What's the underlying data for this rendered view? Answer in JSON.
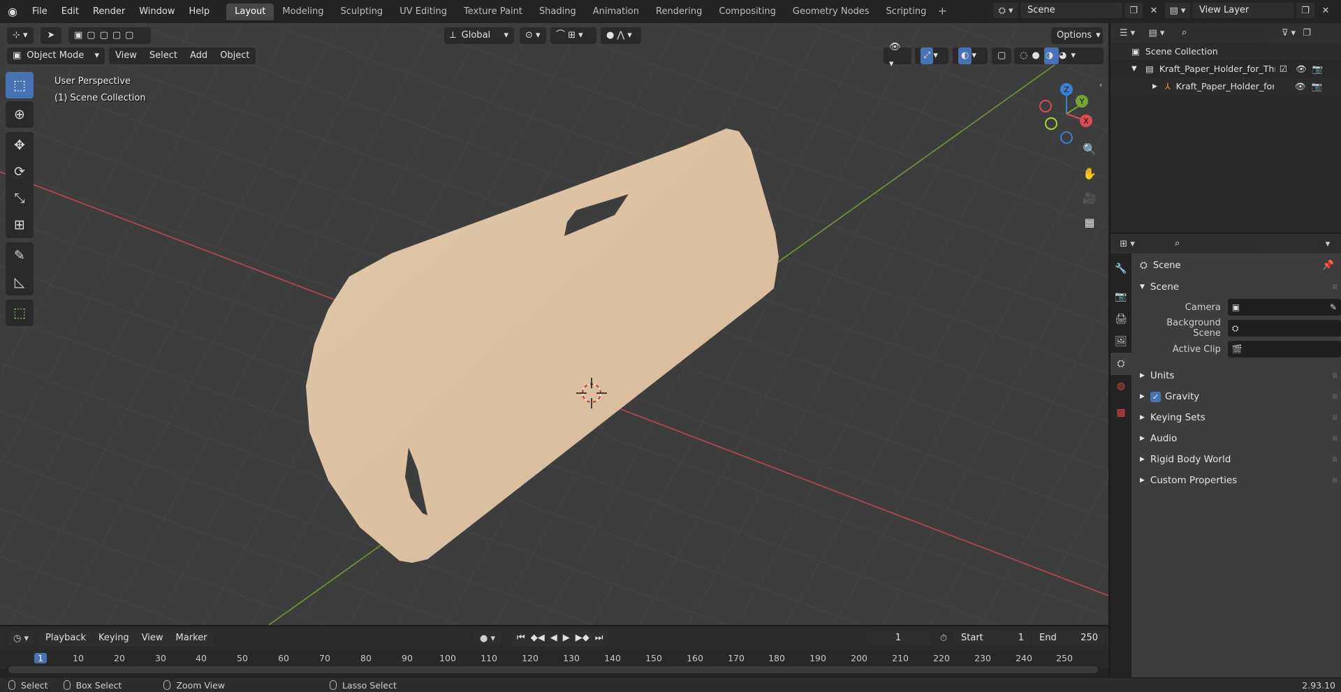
{
  "topbar": {
    "menus": [
      "File",
      "Edit",
      "Render",
      "Window",
      "Help"
    ],
    "workspaces": [
      "Layout",
      "Modeling",
      "Sculpting",
      "UV Editing",
      "Texture Paint",
      "Shading",
      "Animation",
      "Rendering",
      "Compositing",
      "Geometry Nodes",
      "Scripting"
    ],
    "active_workspace": "Layout",
    "scene_name": "Scene",
    "view_layer": "View Layer"
  },
  "viewport": {
    "mode": "Object Mode",
    "menus": [
      "View",
      "Select",
      "Add",
      "Object"
    ],
    "transform_orientation": "Global",
    "options_label": "Options",
    "perspective_label": "User Perspective",
    "collection_label": "(1) Scene Collection",
    "gizmo_axes": {
      "x": "X",
      "y": "Y",
      "z": "Z"
    }
  },
  "outliner": {
    "root": "Scene Collection",
    "collection": "Kraft_Paper_Holder_for_Three",
    "object": "Kraft_Paper_Holder_for_T"
  },
  "properties": {
    "context_title": "Scene",
    "panel_title": "Scene",
    "fields": [
      {
        "label": "Camera",
        "value": ""
      },
      {
        "label": "Background Scene",
        "value": ""
      },
      {
        "label": "Active Clip",
        "value": ""
      }
    ],
    "sections": [
      "Units",
      "Gravity",
      "Keying Sets",
      "Audio",
      "Rigid Body World",
      "Custom Properties"
    ],
    "gravity_checked": true
  },
  "timeline": {
    "menus": [
      "Playback",
      "Keying",
      "View",
      "Marker"
    ],
    "current_frame": "1",
    "start_label": "Start",
    "start_value": "1",
    "end_label": "End",
    "end_value": "250",
    "ticks": [
      "1",
      "10",
      "20",
      "30",
      "40",
      "50",
      "60",
      "70",
      "80",
      "90",
      "100",
      "110",
      "120",
      "130",
      "140",
      "150",
      "160",
      "170",
      "180",
      "190",
      "200",
      "210",
      "220",
      "230",
      "240",
      "250"
    ]
  },
  "statusbar": {
    "items": [
      "Select",
      "Box Select",
      "Zoom View",
      "Lasso Select"
    ],
    "version": "2.93.10"
  },
  "colors": {
    "accent": "#4772b3",
    "object": "#dcc1a3",
    "x_axis": "#b5484f",
    "y_axis": "#6c9a32"
  }
}
